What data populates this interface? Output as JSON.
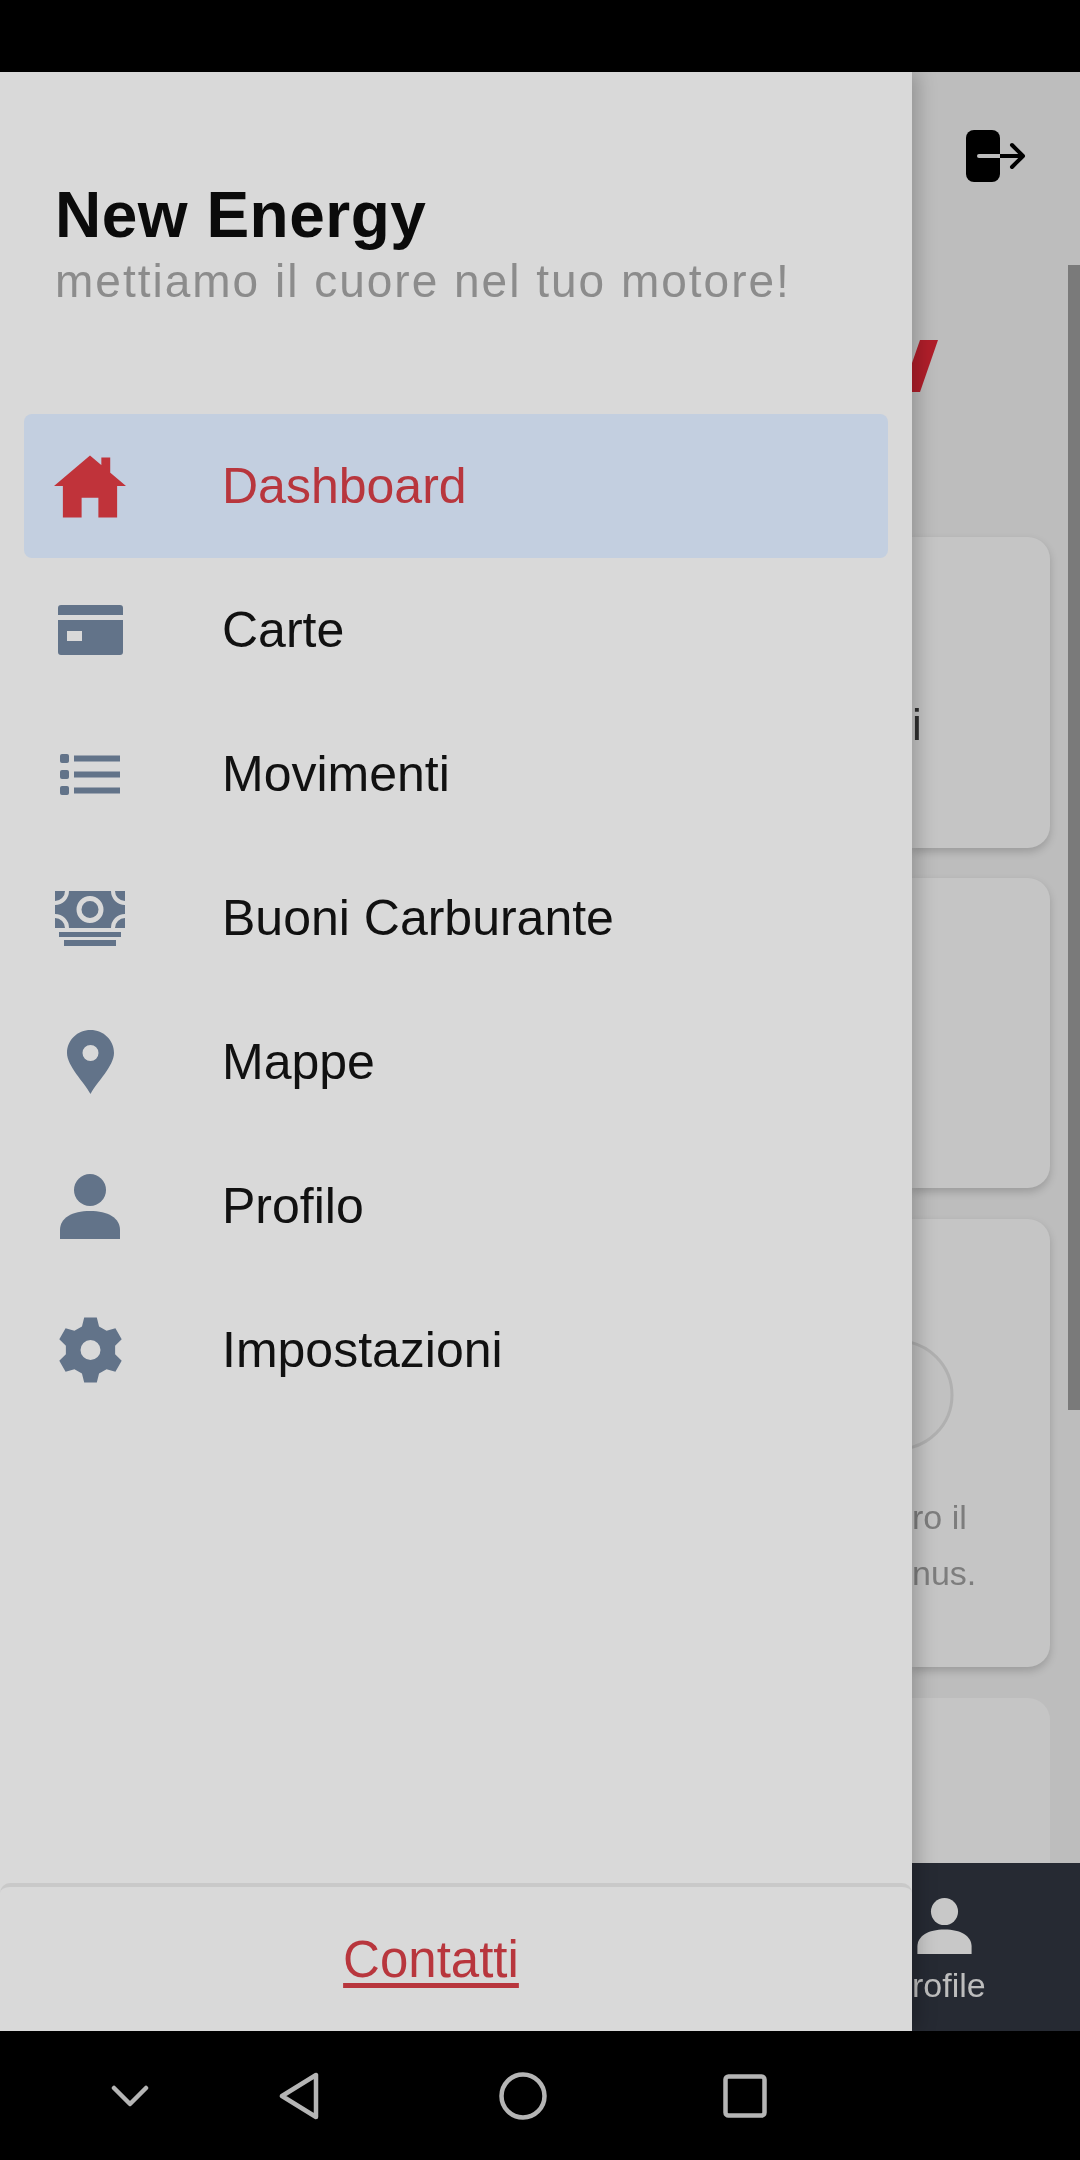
{
  "drawer": {
    "title": "New Energy",
    "subtitle": "mettiamo il cuore nel tuo motore!",
    "menu_items": [
      {
        "label": "Dashboard",
        "selected": true
      },
      {
        "label": "Carte",
        "selected": false
      },
      {
        "label": "Movimenti",
        "selected": false
      },
      {
        "label": "Buoni Carburante",
        "selected": false
      },
      {
        "label": "Mappe",
        "selected": false
      },
      {
        "label": "Profilo",
        "selected": false
      },
      {
        "label": "Impostazioni",
        "selected": false
      }
    ],
    "footer_link": "Contatti"
  },
  "background_page": {
    "first_card_text": "i",
    "third_card_lines": [
      "ro il",
      "nus."
    ],
    "tab_bar_label": "rofile"
  }
}
